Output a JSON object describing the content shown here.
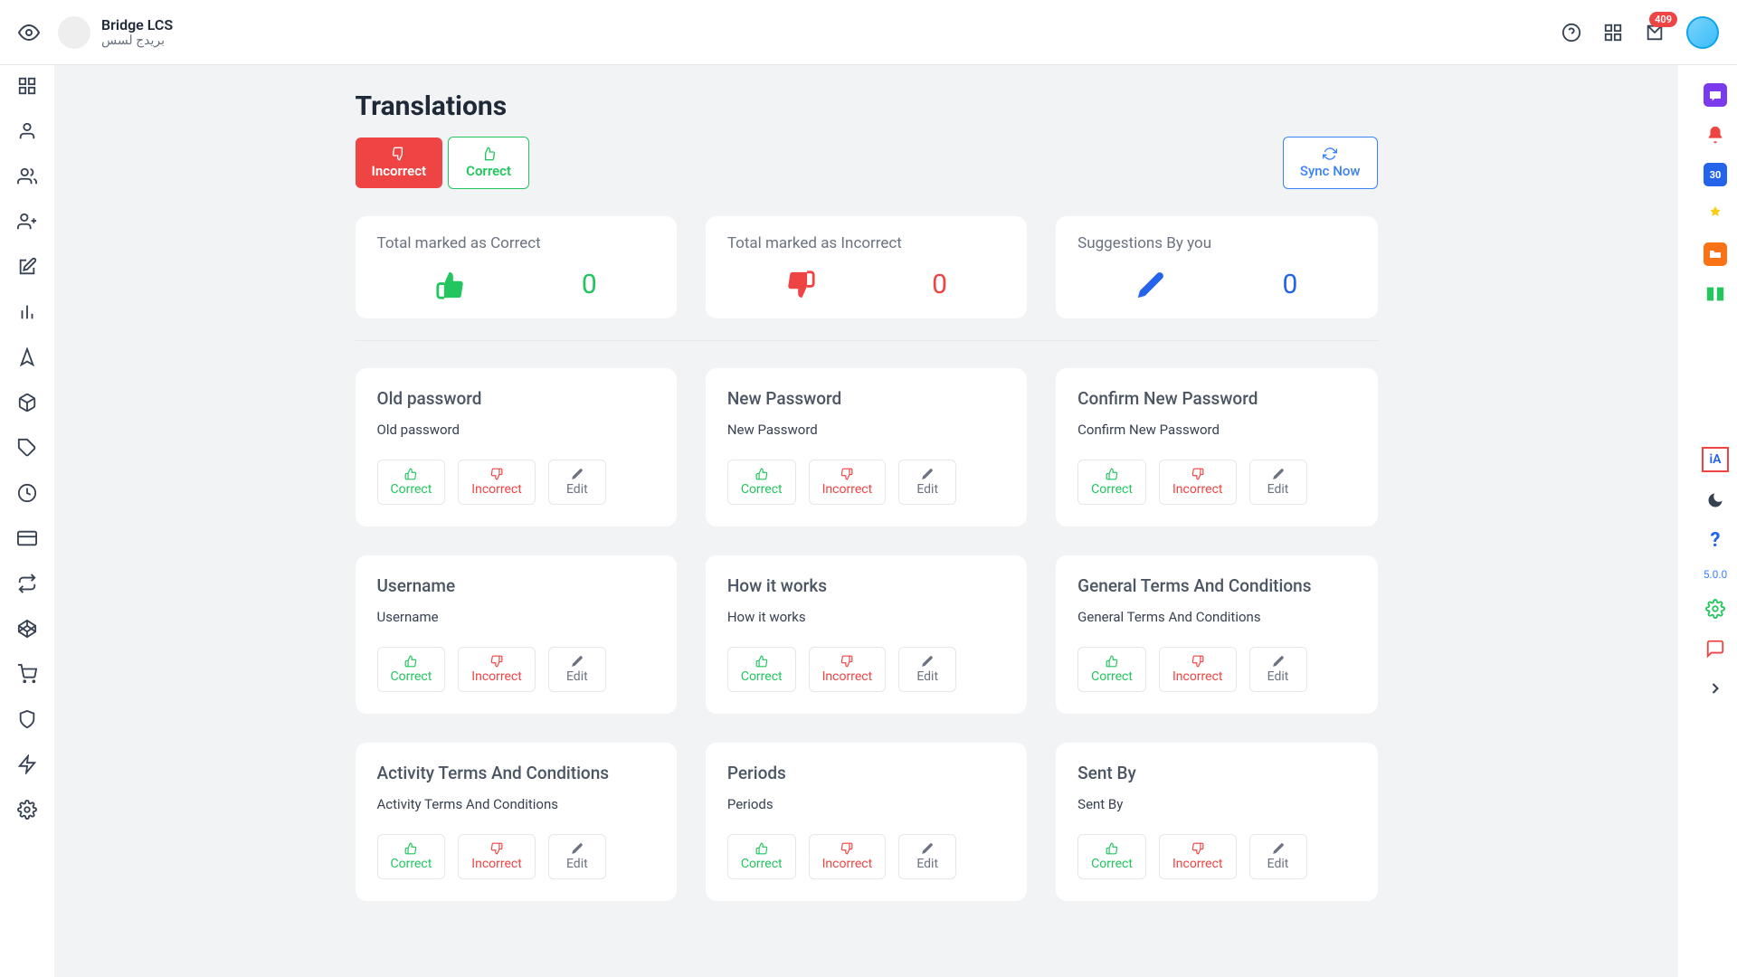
{
  "brand": {
    "title": "Bridge LCS",
    "subtitle": "بريدج لسس"
  },
  "header": {
    "notification_count": "409"
  },
  "page": {
    "title": "Translations",
    "filter_incorrect": "Incorrect",
    "filter_correct": "Correct",
    "sync_now": "Sync Now"
  },
  "stats": [
    {
      "title": "Total marked as Correct",
      "value": "0",
      "color": "green",
      "icon": "thumb-up"
    },
    {
      "title": "Total marked as Incorrect",
      "value": "0",
      "color": "red",
      "icon": "thumb-down"
    },
    {
      "title": "Suggestions By you",
      "value": "0",
      "color": "blue",
      "icon": "pencil"
    }
  ],
  "actions": {
    "correct": "Correct",
    "incorrect": "Incorrect",
    "edit": "Edit"
  },
  "cards": [
    {
      "title": "Old password",
      "sub": "Old password"
    },
    {
      "title": "New Password",
      "sub": "New Password"
    },
    {
      "title": "Confirm New Password",
      "sub": "Confirm New Password"
    },
    {
      "title": "Username",
      "sub": "Username"
    },
    {
      "title": "How it works",
      "sub": "How it works"
    },
    {
      "title": "General Terms And Conditions",
      "sub": "General Terms And Conditions"
    },
    {
      "title": "Activity Terms And Conditions",
      "sub": "Activity Terms And Conditions"
    },
    {
      "title": "Periods",
      "sub": "Periods"
    },
    {
      "title": "Sent By",
      "sub": "Sent By"
    }
  ],
  "right_sidebar": {
    "calendar_day": "30",
    "language_label": "iA",
    "version": "5.0.0"
  }
}
